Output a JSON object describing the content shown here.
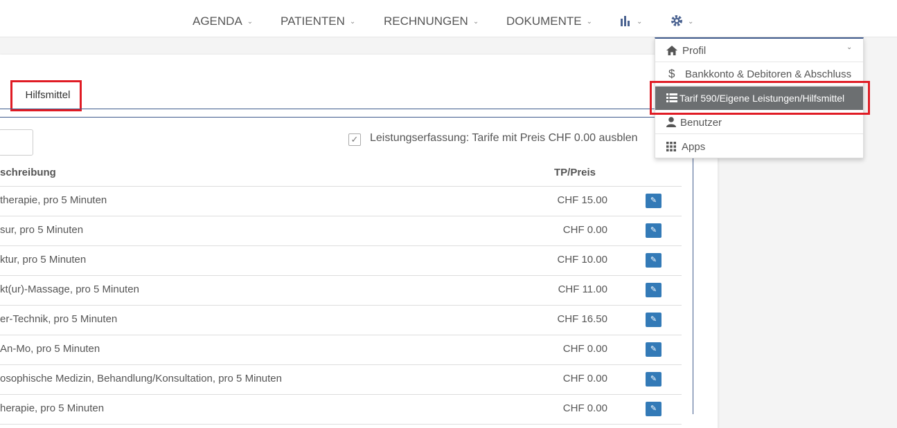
{
  "nav": {
    "agenda": "AGENDA",
    "patienten": "PATIENTEN",
    "rechnungen": "RECHNUNGEN",
    "dokumente": "DOKUMENTE",
    "chevron": "⌄"
  },
  "tab": {
    "label": "Hilfsmittel"
  },
  "filter": {
    "checkbox_label": "Leistungserfassung: Tarife mit Preis CHF 0.00 ausblen",
    "checked": true
  },
  "table": {
    "headers": {
      "description": "schreibung",
      "price": "TP/Preis"
    },
    "rows": [
      {
        "desc": "therapie, pro 5 Minuten",
        "price": "CHF 15.00"
      },
      {
        "desc": "sur, pro 5 Minuten",
        "price": "CHF 0.00"
      },
      {
        "desc": "ktur, pro 5 Minuten",
        "price": "CHF 10.00"
      },
      {
        "desc": "kt(ur)-Massage, pro 5 Minuten",
        "price": "CHF 11.00"
      },
      {
        "desc": "er-Technik, pro 5 Minuten",
        "price": "CHF 16.50"
      },
      {
        "desc": "An-Mo, pro 5 Minuten",
        "price": "CHF 0.00"
      },
      {
        "desc": "osophische Medizin, Behandlung/Konsultation, pro 5 Minuten",
        "price": "CHF 0.00"
      },
      {
        "desc": "herapie, pro 5 Minuten",
        "price": "CHF 0.00"
      }
    ]
  },
  "dropdown": {
    "items": [
      {
        "label": "Profil",
        "icon": "home-icon"
      },
      {
        "label": "Bankkonto & Debitoren & Abschluss",
        "icon": "dollar-icon"
      },
      {
        "label": "Tarif 590/Eigene Leistungen/Hilfsmittel",
        "icon": "list-icon"
      },
      {
        "label": "Benutzer",
        "icon": "user-icon"
      },
      {
        "label": "Apps",
        "icon": "grid-icon"
      }
    ]
  },
  "colors": {
    "accent": "#3f5a8c",
    "highlight": "#e01b24",
    "button": "#337ab7",
    "active_menu": "#6c6f71"
  }
}
